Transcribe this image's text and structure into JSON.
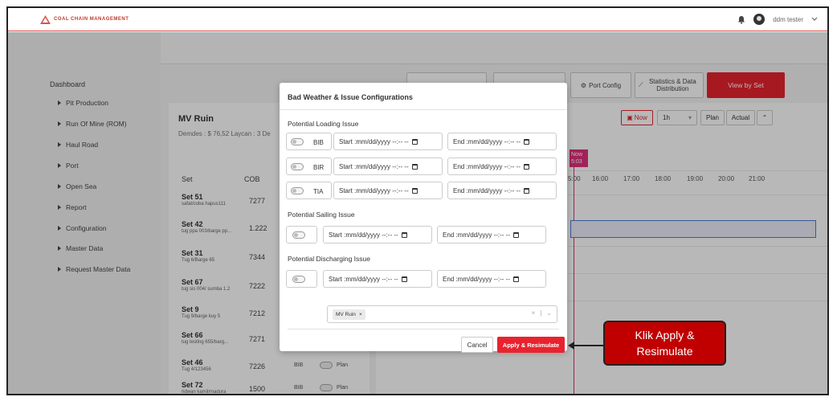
{
  "app": {
    "logo_text": "COAL CHAIN MANAGEMENT",
    "user_name": "ddm tester"
  },
  "sidebar": {
    "title": "Dashboard",
    "items": [
      {
        "label": "Pit Production"
      },
      {
        "label": "Run Of Mine (ROM)"
      },
      {
        "label": "Haul Road"
      },
      {
        "label": "Port"
      },
      {
        "label": "Open Sea"
      },
      {
        "label": "Report"
      },
      {
        "label": "Configuration"
      },
      {
        "label": "Master Data"
      },
      {
        "label": "Request Master Data"
      }
    ]
  },
  "toolbar": {
    "port_config": "Port Config",
    "stats": "Statistics & Data Distribution",
    "view_by_set": "View by Set",
    "now": "Now",
    "interval": "1h",
    "plan": "Plan",
    "actual": "Actual"
  },
  "vessel": {
    "title": "MV Ruin",
    "meta": "Demdes : $ 76,52   Laycan : 3 De"
  },
  "table": {
    "headers": {
      "set": "Set",
      "cob": "COB"
    },
    "rows": [
      {
        "name": "Set 51",
        "sub": "safat/coba hapus111",
        "cob": "7277",
        "tag": "",
        "plan": ""
      },
      {
        "name": "Set 42",
        "sub": "tug ppa 003/barge pp...",
        "cob": "1.222",
        "tag": "",
        "plan": ""
      },
      {
        "name": "Set 31",
        "sub": "Tug 6/Barge 65",
        "cob": "7344",
        "tag": "",
        "plan": ""
      },
      {
        "name": "Set 67",
        "sub": "tug sis 004/ sumba 1.2",
        "cob": "7222",
        "tag": "",
        "plan": ""
      },
      {
        "name": "Set 9",
        "sub": "Tug 9/barge kuy 5",
        "cob": "7212",
        "tag": "",
        "plan": ""
      },
      {
        "name": "Set 66",
        "sub": "tug testing 655/barg...",
        "cob": "7271",
        "tag": "",
        "plan": ""
      },
      {
        "name": "Set 46",
        "sub": "Tug 4/123456",
        "cob": "7226",
        "tag": "BIB",
        "plan": "Plan"
      },
      {
        "name": "Set 72",
        "sub": "ridwan kamil/madura",
        "cob": "1500",
        "tag": "BIB",
        "plan": "Plan"
      }
    ]
  },
  "timeline": {
    "now_label": "Now",
    "now_time": "5:03",
    "hours": [
      "5:00",
      "16:00",
      "17:00",
      "18:00",
      "19:00",
      "20:00",
      "21:00"
    ]
  },
  "modal": {
    "title": "Bad Weather & Issue Configurations",
    "loading_section": "Potential Loading Issue",
    "loading_rows": [
      {
        "label": "BIB",
        "start": "Start :mm/dd/yyyy --:-- --",
        "end": "End :mm/dd/yyyy --:-- --"
      },
      {
        "label": "BIR",
        "start": "Start :mm/dd/yyyy --:-- --",
        "end": "End :mm/dd/yyyy --:-- --"
      },
      {
        "label": "TIA",
        "start": "Start :mm/dd/yyyy --:-- --",
        "end": "End :mm/dd/yyyy --:-- --"
      }
    ],
    "sailing_section": "Potential Sailing Issue",
    "sailing": {
      "start": "Start :mm/dd/yyyy --:-- --",
      "end": "End :mm/dd/yyyy --:-- --"
    },
    "discharging_section": "Potential Discharging Issue",
    "discharging": {
      "start": "Start :mm/dd/yyyy --:-- --",
      "end": "End :mm/dd/yyyy --:-- --"
    },
    "selected_vessel": "MV Ruin",
    "cancel": "Cancel",
    "apply": "Apply & Resimulate"
  },
  "callout": {
    "line1": "Klik Apply &",
    "line2": "Resimulate"
  },
  "colors": {
    "accent": "#e8232f",
    "now_marker": "#e0307a",
    "callout": "#c00000"
  }
}
